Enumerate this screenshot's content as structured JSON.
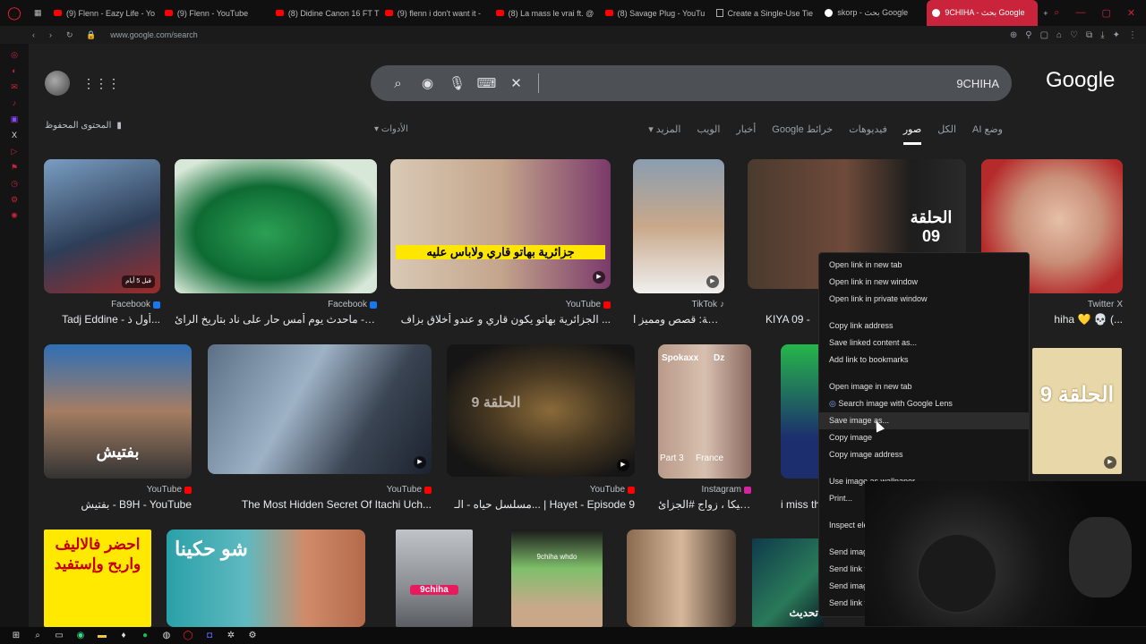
{
  "tabs": [
    {
      "label": "(9) Flenn - Eazy Life - Yo",
      "icon": "youtube-icon"
    },
    {
      "label": "(9) Flenn - YouTube",
      "icon": "youtube-icon"
    },
    {
      "label": "(8) Didine Canon 16 FT T",
      "icon": "youtube-icon"
    },
    {
      "label": "(9) flenn i don't want it -",
      "icon": "youtube-icon"
    },
    {
      "label": "(8) La mass le vrai ft. @",
      "icon": "youtube-icon"
    },
    {
      "label": "(8) Savage Plug - YouTu",
      "icon": "youtube-icon"
    },
    {
      "label": "Create a Single-Use Tie",
      "icon": "document-icon"
    },
    {
      "label": "skorp - بحث Google",
      "icon": "google-icon"
    },
    {
      "label": "9CHIHA - بحث Google",
      "icon": "google-icon",
      "active": true
    }
  ],
  "address": {
    "url": "www.google.com/search"
  },
  "search": {
    "query": "9CHIHA",
    "logo": "Google"
  },
  "saved_label": "المحتوى المحفوظ",
  "tools_label": "الأدوات",
  "nav_tabs": [
    "وضع AI",
    "الكل",
    "صور",
    "فيديوهات",
    "خرائط Google",
    "أخبار",
    "الويب",
    "المزيد"
  ],
  "active_tab": "صور",
  "results_row1": [
    {
      "source": "Facebook",
      "title": "Tadj Eddine - أول ذ...",
      "badge": "قبل 5 أيام"
    },
    {
      "source": "Facebook",
      "title": "معا - ماحدث يوم أمس حار على ناد بتاريخ الرائ..."
    },
    {
      "source": "YouTube",
      "title": "الجزائرية بهاتو يكون قاري و عندو أخلاق بزاف ...",
      "caption": "جزائرية بهاتو قاري ولاباس عليه"
    },
    {
      "source": "TikTok",
      "title": "قشيحة: قصص ومميز ا..."
    },
    {
      "source": "",
      "title": "KIYA 09 -",
      "caption": "الحلقة 09"
    },
    {
      "source": "Twitter",
      "title": "hiha 💛 💀 (..."
    }
  ],
  "results_row2": [
    {
      "source": "YouTube",
      "title": "بفتيش - B9H - YouTube",
      "caption": "بفتيش"
    },
    {
      "source": "YouTube",
      "title": "The Most Hidden Secret Of Itachi Uch..."
    },
    {
      "source": "YouTube",
      "title": "مسلسل حياه - الـ... | Hayet - Episode 9",
      "caption": "الحلقة 9"
    },
    {
      "source": "Instagram",
      "title": "سبيكا ، زواج #الجزائ...",
      "tags": [
        "Spokaxx",
        "Dz",
        "Part 3",
        "France"
      ]
    },
    {
      "source": "",
      "title": "i miss th"
    },
    {
      "source": "",
      "title": "",
      "caption": "الحلقة 9"
    }
  ],
  "results_row3": [
    {
      "caption": "احضر فالاليف واربح وإستفيد"
    },
    {
      "caption": "شو حكينا"
    },
    {
      "caption": "9chiha"
    },
    {
      "caption": "9chiha whdo"
    },
    {
      "caption": ""
    },
    {
      "caption": "تحديث"
    }
  ],
  "context_menu": {
    "group1": [
      "Open link in new tab",
      "Open link in new window",
      "Open link in private window"
    ],
    "group2": [
      "Copy link address",
      "Save linked content as...",
      "Add link to bookmarks"
    ],
    "group3": [
      "Open image in new tab",
      "Search image with Google Lens",
      "Save image as...",
      "Copy image",
      "Copy image address"
    ],
    "group4": [
      "Use image as wallpaper",
      "Print..."
    ],
    "group5": [
      "Inspect ele"
    ],
    "group6": [
      "Send imag",
      "Send link t",
      "Send imag",
      "Send link t"
    ],
    "highlighted": "Save image as..."
  },
  "colors": {
    "accent": "#c9243b",
    "background": "#1f1f1f",
    "searchbox": "#4d5156"
  }
}
